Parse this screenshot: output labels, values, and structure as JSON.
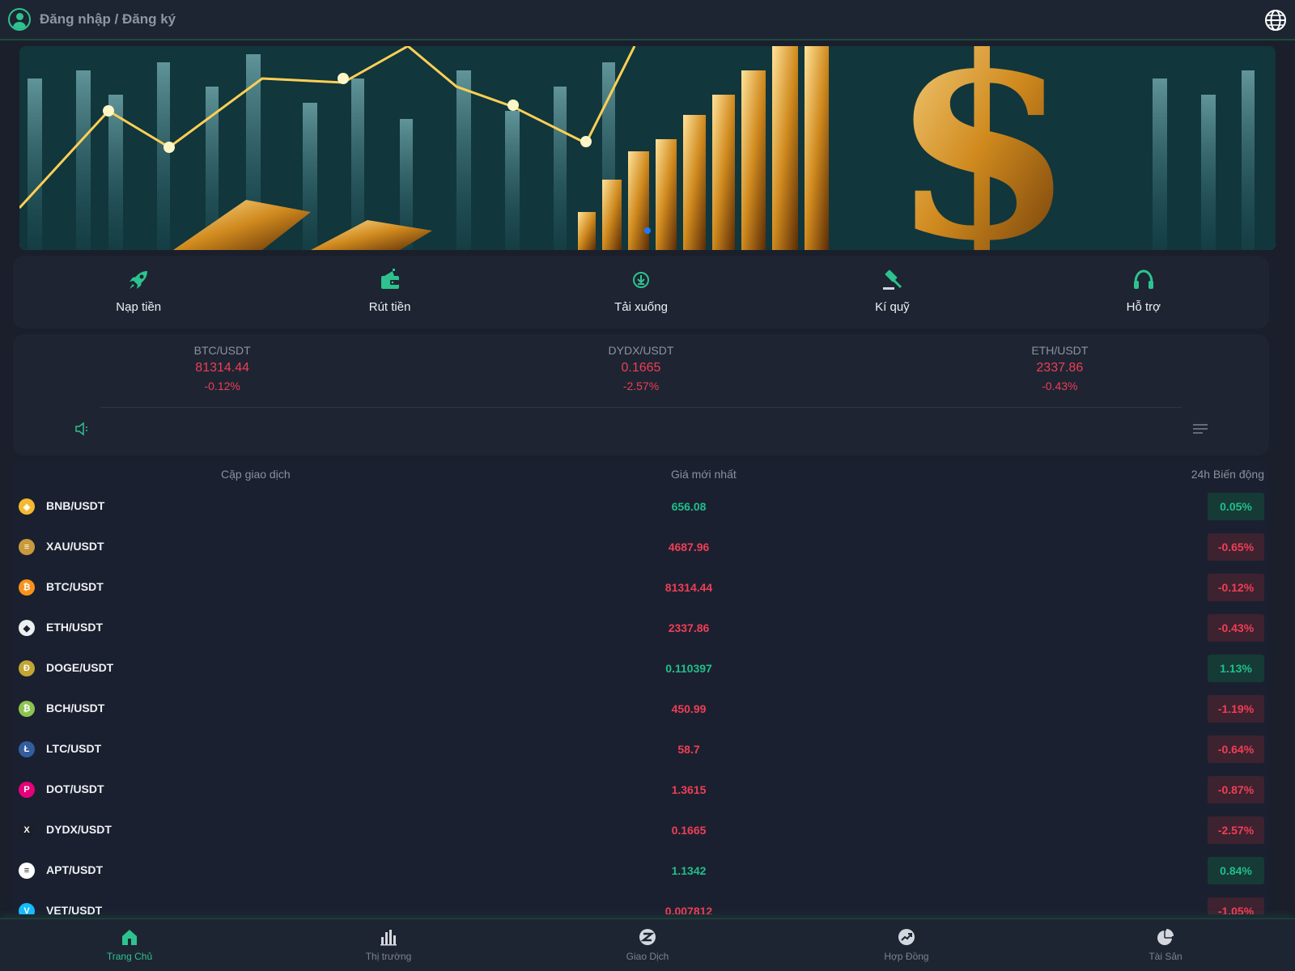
{
  "header": {
    "login_label": "Đăng nhập / Đăng ký"
  },
  "banner": {
    "active_slide": 1,
    "slide_count": 1
  },
  "actions": [
    {
      "label": "Nạp tiền",
      "icon": "rocket-icon"
    },
    {
      "label": "Rút tiền",
      "icon": "wallet-icon"
    },
    {
      "label": "Tải xuống",
      "icon": "download-icon"
    },
    {
      "label": "Kí quỹ",
      "icon": "gavel-icon"
    },
    {
      "label": "Hỗ trợ",
      "icon": "headset-icon"
    }
  ],
  "tickers": [
    {
      "pair": "BTC/USDT",
      "price": "81314.44",
      "change": "-0.12%"
    },
    {
      "pair": "DYDX/USDT",
      "price": "0.1665",
      "change": "-2.57%"
    },
    {
      "pair": "ETH/USDT",
      "price": "2337.86",
      "change": "-0.43%"
    }
  ],
  "market": {
    "headers": {
      "pair": "Cặp giao dịch",
      "price": "Giá mới nhất",
      "change": "24h Biến động"
    },
    "rows": [
      {
        "pair": "BNB/USDT",
        "price": "656.08",
        "change": "0.05%",
        "dir": "up",
        "icon_color": "#f3ba2f",
        "glyph": "◈"
      },
      {
        "pair": "XAU/USDT",
        "price": "4687.96",
        "change": "-0.65%",
        "dir": "down",
        "icon_color": "#c99a3c",
        "glyph": "≡"
      },
      {
        "pair": "BTC/USDT",
        "price": "81314.44",
        "change": "-0.12%",
        "dir": "down",
        "icon_color": "#f7931a",
        "glyph": "₿"
      },
      {
        "pair": "ETH/USDT",
        "price": "2337.86",
        "change": "-0.43%",
        "dir": "down",
        "icon_color": "#ecf0f1",
        "glyph": "◆"
      },
      {
        "pair": "DOGE/USDT",
        "price": "0.110397",
        "change": "1.13%",
        "dir": "up",
        "icon_color": "#c2a633",
        "glyph": "Ð"
      },
      {
        "pair": "BCH/USDT",
        "price": "450.99",
        "change": "-1.19%",
        "dir": "down",
        "icon_color": "#8dc351",
        "glyph": "₿"
      },
      {
        "pair": "LTC/USDT",
        "price": "58.7",
        "change": "-0.64%",
        "dir": "down",
        "icon_color": "#345d9d",
        "glyph": "Ł"
      },
      {
        "pair": "DOT/USDT",
        "price": "1.3615",
        "change": "-0.87%",
        "dir": "down",
        "icon_color": "#e6007a",
        "glyph": "P"
      },
      {
        "pair": "DYDX/USDT",
        "price": "0.1665",
        "change": "-2.57%",
        "dir": "down",
        "icon_color": "#1b1f2a",
        "glyph": "X"
      },
      {
        "pair": "APT/USDT",
        "price": "1.1342",
        "change": "0.84%",
        "dir": "up",
        "icon_color": "#ffffff",
        "glyph": "≡"
      },
      {
        "pair": "VET/USDT",
        "price": "0.007812",
        "change": "-1.05%",
        "dir": "down",
        "icon_color": "#15bdff",
        "glyph": "V"
      }
    ]
  },
  "nav": [
    {
      "label": "Trang Chủ",
      "icon": "home-icon",
      "active": true
    },
    {
      "label": "Thị trường",
      "icon": "bar-chart-icon",
      "active": false
    },
    {
      "label": "Giao Dịch",
      "icon": "exchange-icon",
      "active": false
    },
    {
      "label": "Hợp Đồng",
      "icon": "trend-icon",
      "active": false
    },
    {
      "label": "Tài Sản",
      "icon": "pie-chart-icon",
      "active": false
    }
  ],
  "colors": {
    "accent": "#2ec28f",
    "up": "#1fbf8a",
    "down": "#ef3e54",
    "background": "#1a1f2b",
    "panel": "#1e2432"
  }
}
